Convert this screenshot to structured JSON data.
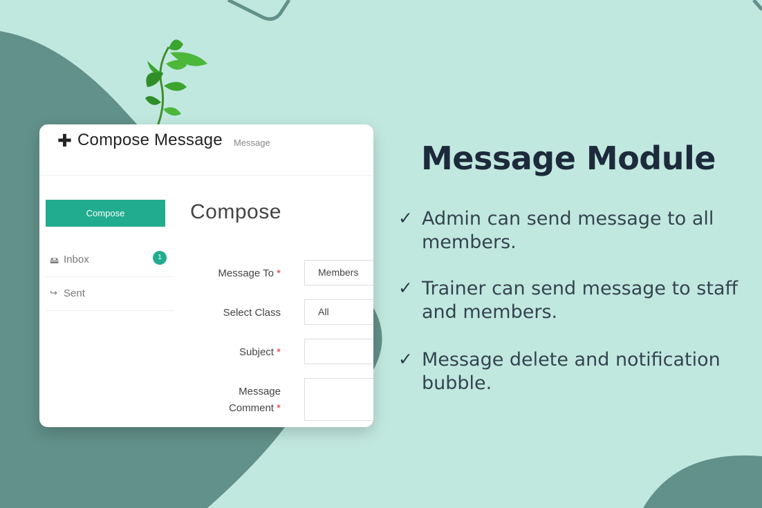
{
  "colors": {
    "background": "#c1e8df",
    "dark_shape": "#62908a",
    "accent": "#22ac8f",
    "leaf": "#3aa42e"
  },
  "card": {
    "header": {
      "icon": "plus-icon",
      "icon_glyph": "✚",
      "title": "Compose Message",
      "subtitle": "Message"
    },
    "sidebar": {
      "compose_label": "Compose",
      "items": [
        {
          "icon": "inbox-icon",
          "glyph": "🖴",
          "label": "Inbox",
          "badge": "1"
        },
        {
          "icon": "sign-out-icon",
          "glyph": "↪",
          "label": "Sent"
        }
      ]
    },
    "form": {
      "title": "Compose",
      "required_mark": "*",
      "fields": [
        {
          "label": "Message To",
          "required": true,
          "value": "Members"
        },
        {
          "label": "Select Class",
          "required": false,
          "value": "All"
        },
        {
          "label": "Subject",
          "required": true,
          "value": ""
        },
        {
          "label_line1": "Message",
          "label_line2": "Comment",
          "required": true,
          "value": ""
        }
      ]
    }
  },
  "promo": {
    "title": "Message Module",
    "check_icon": "✓",
    "features": [
      "Admin can send message to all members.",
      "Trainer can send message to staff and members.",
      "Message delete and notification bubble."
    ]
  }
}
